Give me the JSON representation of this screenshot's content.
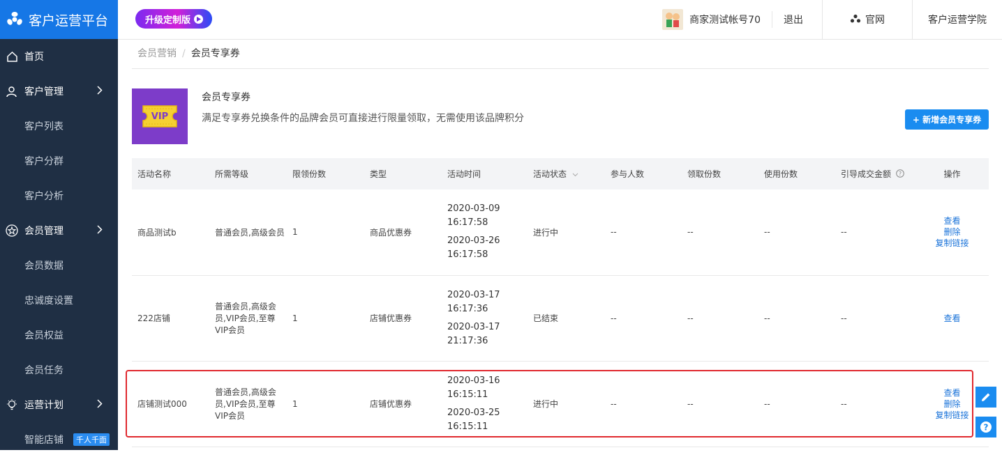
{
  "app": {
    "title": "客户运营平台"
  },
  "sidebar": {
    "items": [
      {
        "label": "首页"
      },
      {
        "label": "客户管理"
      },
      {
        "label": "客户列表"
      },
      {
        "label": "客户分群"
      },
      {
        "label": "客户分析"
      },
      {
        "label": "会员管理"
      },
      {
        "label": "会员数据"
      },
      {
        "label": "忠诚度设置"
      },
      {
        "label": "会员权益"
      },
      {
        "label": "会员任务"
      },
      {
        "label": "运营计划"
      },
      {
        "label": "智能店铺",
        "badge": "千人千面"
      }
    ]
  },
  "topbar": {
    "upgrade_label": "升级定制版",
    "account": "商家测试帐号70",
    "logout": "退出",
    "official_site": "官网",
    "academy": "客户运营学院"
  },
  "breadcrumb": {
    "parent": "会员营销",
    "separator": "/",
    "current": "会员专享券"
  },
  "intro": {
    "image_text": "VIP",
    "title": "会员专享券",
    "description": "满足专享券兑换条件的品牌会员可直接进行限量领取，无需使用该品牌积分",
    "add_button": "+ 新增会员专享券"
  },
  "table": {
    "headers": [
      "活动名称",
      "所需等级",
      "限领份数",
      "类型",
      "活动时间",
      "活动状态",
      "参与人数",
      "领取份数",
      "使用份数",
      "引导成交金额",
      "操作"
    ],
    "rows": [
      {
        "name": "商品测试b",
        "level": "普通会员,高级会员",
        "limit": "1",
        "type": "商品优惠券",
        "start_date": "2020-03-09",
        "start_time": "16:17:58",
        "end_date": "2020-03-26",
        "end_time": "16:17:58",
        "status": "进行中",
        "participants": "--",
        "received": "--",
        "used": "--",
        "amount": "--",
        "actions": [
          "查看",
          "删除",
          "复制链接"
        ]
      },
      {
        "name": "222店铺",
        "level": "普通会员,高级会员,VIP会员,至尊VIP会员",
        "limit": "1",
        "type": "店铺优惠券",
        "start_date": "2020-03-17",
        "start_time": "16:17:36",
        "end_date": "2020-03-17",
        "end_time": "21:17:36",
        "status": "已结束",
        "participants": "--",
        "received": "--",
        "used": "--",
        "amount": "--",
        "actions": [
          "查看"
        ]
      },
      {
        "name": "店铺测试000",
        "level": "普通会员,高级会员,VIP会员,至尊VIP会员",
        "limit": "1",
        "type": "店铺优惠券",
        "start_date": "2020-03-16",
        "start_time": "16:15:11",
        "end_date": "2020-03-25",
        "end_time": "16:15:11",
        "status": "进行中",
        "participants": "--",
        "received": "--",
        "used": "--",
        "amount": "--",
        "actions": [
          "查看",
          "删除",
          "复制链接"
        ]
      }
    ]
  },
  "floating": {
    "edit_icon": "pencil-icon",
    "help_icon": "question-icon"
  }
}
